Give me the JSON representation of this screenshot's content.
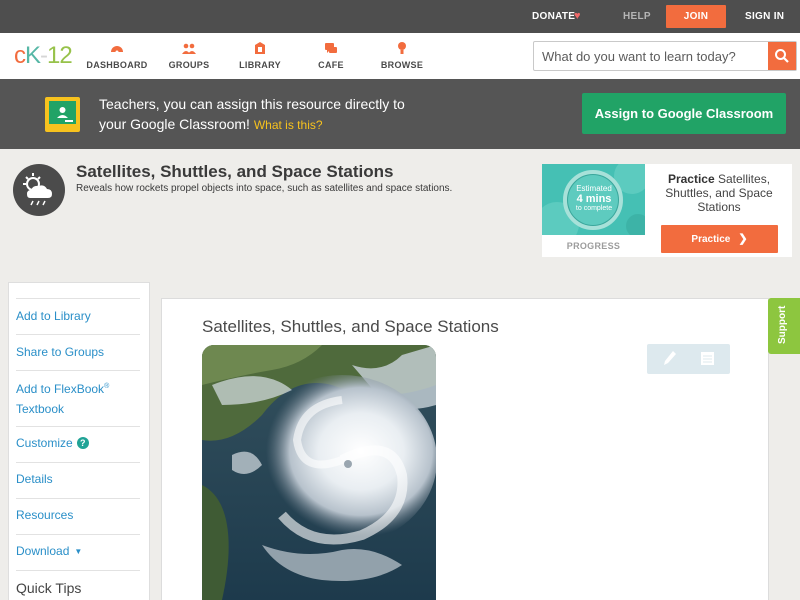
{
  "topbar": {
    "donate": "DONATE",
    "help": "HELP",
    "join": "JOIN",
    "sign_in": "SIGN IN"
  },
  "logo": {
    "c": "c",
    "k": "K",
    "dash": "-",
    "num": "12"
  },
  "nav": {
    "items": [
      {
        "label": "DASHBOARD",
        "icon": "dashboard-icon"
      },
      {
        "label": "GROUPS",
        "icon": "groups-icon"
      },
      {
        "label": "LIBRARY",
        "icon": "library-icon"
      },
      {
        "label": "CAFE",
        "icon": "cafe-icon"
      },
      {
        "label": "BROWSE",
        "icon": "browse-icon"
      }
    ]
  },
  "search": {
    "placeholder": "What do you want to learn today?",
    "value": ""
  },
  "banner": {
    "line1": "Teachers, you can assign this resource directly to",
    "line2": "your Google Classroom!",
    "what_link": "What is this?",
    "assign_button": "Assign to Google Classroom"
  },
  "concept": {
    "title": "Satellites, Shuttles, and Space Stations",
    "description": "Reveals how rockets propel objects into space, such as satellites and space stations."
  },
  "practice_card": {
    "estimated": "Estimated",
    "mins": "4 mins",
    "to_complete": "to complete",
    "progress_label": "PROGRESS",
    "practice_word": "Practice",
    "practice_topic": "Satellites, Shuttles, and Space Stations",
    "practice_button": "Practice"
  },
  "sidebar": {
    "items": [
      {
        "label": "Add to Library"
      },
      {
        "label": "Share to Groups"
      },
      {
        "label": "Add to FlexBook",
        "sup": "®",
        "label2": "Textbook"
      },
      {
        "label": "Customize",
        "badge": "?"
      },
      {
        "label": "Details"
      },
      {
        "label": "Resources"
      },
      {
        "label": "Download",
        "caret": "▼"
      }
    ],
    "quick_tips": "Quick Tips"
  },
  "content": {
    "title": "Satellites, Shuttles, and Space Stations"
  },
  "support_tab": "Support",
  "colors": {
    "accent_orange": "#f26c3e",
    "classroom_green": "#21a366",
    "link_blue": "#2a8fc8",
    "support_green": "#8dc63f"
  }
}
